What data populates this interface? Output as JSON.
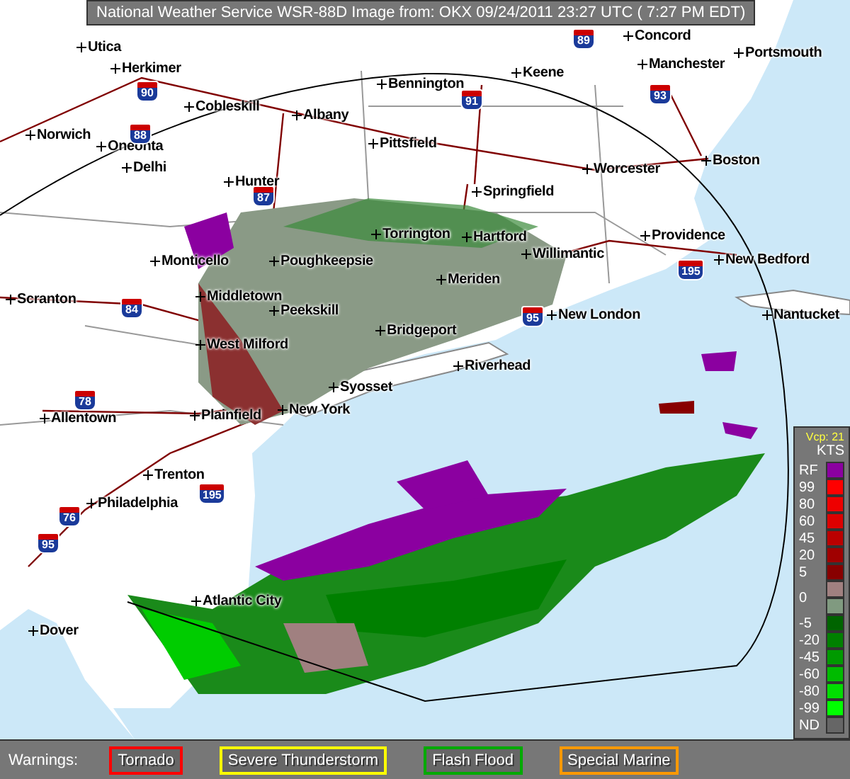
{
  "banner": {
    "text": "National Weather Service WSR-88D Image from: OKX 09/24/2011 23:27 UTC ( 7:27 PM EDT)"
  },
  "map": {
    "cities": [
      "Concord",
      "Utica",
      "Portsmouth",
      "Herkimer",
      "Keene",
      "Manchester",
      "Bennington",
      "Cobleskill",
      "Albany",
      "Norwich",
      "Oneonta",
      "Pittsfield",
      "Boston",
      "Delhi",
      "Worcester",
      "Hunter",
      "Springfield",
      "Torrington",
      "Hartford",
      "Providence",
      "Willimantic",
      "Monticello",
      "Poughkeepsie",
      "New Bedford",
      "Meriden",
      "Scranton",
      "Middletown",
      "Peekskill",
      "New London",
      "Nantucket",
      "Bridgeport",
      "West Milford",
      "Riverhead",
      "Syosset",
      "Allentown",
      "Plainfield",
      "New York",
      "Trenton",
      "Philadelphia",
      "Atlantic City",
      "Dover"
    ],
    "shields": [
      "89",
      "90",
      "91",
      "93",
      "88",
      "87",
      "195",
      "84",
      "95",
      "78",
      "195",
      "76",
      "95"
    ]
  },
  "legend": {
    "mode": "Vcp: 21",
    "unit": "KTS",
    "items": [
      {
        "label": "RF",
        "color": "#8b00a0"
      },
      {
        "label": "99",
        "color": "#ff0000"
      },
      {
        "label": "80",
        "color": "#ee0000"
      },
      {
        "label": "60",
        "color": "#dd0000"
      },
      {
        "label": "45",
        "color": "#bb0000"
      },
      {
        "label": "20",
        "color": "#a00000"
      },
      {
        "label": "5",
        "color": "#880000"
      },
      {
        "label": "0",
        "color": "#a08080"
      },
      {
        "color": "#809a80"
      },
      {
        "label": "-5",
        "color": "#006400"
      },
      {
        "label": "-20",
        "color": "#008000"
      },
      {
        "label": "-45",
        "color": "#009a00"
      },
      {
        "label": "-60",
        "color": "#00bb00"
      },
      {
        "label": "-80",
        "color": "#00dd00"
      },
      {
        "label": "-99",
        "color": "#00ff00"
      },
      {
        "label": "ND",
        "color": "#666666"
      }
    ]
  },
  "warnings": {
    "label": "Warnings:",
    "items": [
      {
        "label": "Tornado",
        "color": "#ff0000"
      },
      {
        "label": "Severe Thunderstorm",
        "color": "#ffff00"
      },
      {
        "label": "Flash Flood",
        "color": "#00aa00"
      },
      {
        "label": "Special Marine",
        "color": "#ff9900"
      }
    ]
  }
}
